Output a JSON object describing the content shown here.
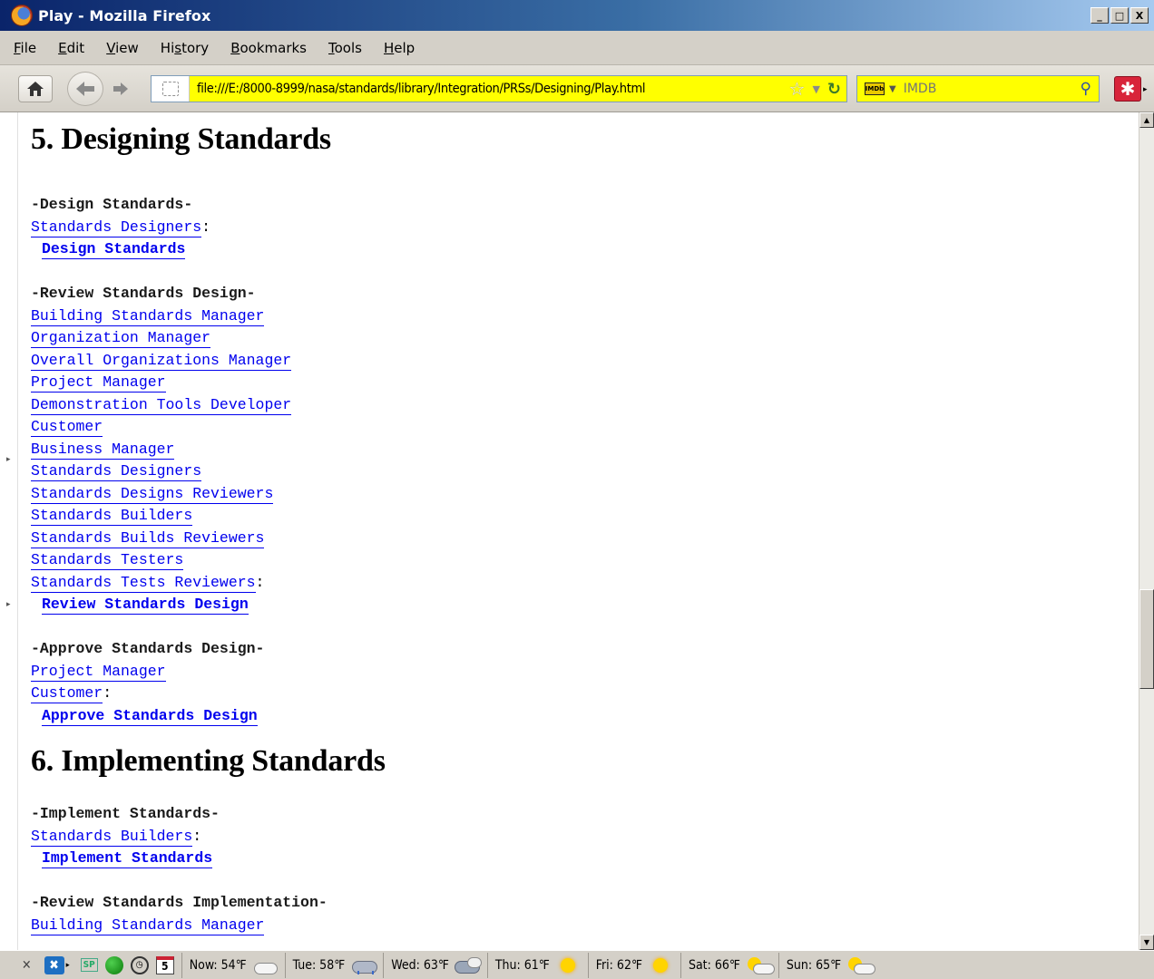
{
  "window": {
    "title": "Play - Mozilla Firefox",
    "buttons": {
      "minimize": "_",
      "maximize": "□",
      "close": "X"
    }
  },
  "menu": [
    {
      "prefix": "",
      "underlined": "F",
      "rest": "ile"
    },
    {
      "prefix": "",
      "underlined": "E",
      "rest": "dit"
    },
    {
      "prefix": "",
      "underlined": "V",
      "rest": "iew"
    },
    {
      "prefix": "Hi",
      "underlined": "s",
      "rest": "tory"
    },
    {
      "prefix": "",
      "underlined": "B",
      "rest": "ookmarks"
    },
    {
      "prefix": "",
      "underlined": "T",
      "rest": "ools"
    },
    {
      "prefix": "",
      "underlined": "H",
      "rest": "elp"
    }
  ],
  "navbar": {
    "url": "file:///E:/8000-8999/nasa/standards/library/Integration/PRSs/Designing/Play.html",
    "search_engine": "IMDB",
    "search_placeholder": "IMDB",
    "icons": {
      "home": "home-icon",
      "back": "back-arrow-icon",
      "forward": "forward-arrow-icon",
      "bookmark_star": "star-icon",
      "reload": "reload-icon",
      "search": "magnifier-icon",
      "addon": "addon-icon"
    },
    "accent_color": "#ffff00"
  },
  "content": {
    "link_color": "#0000ee",
    "section5": {
      "heading": "5. Designing Standards",
      "design": {
        "label": "-Design Standards-",
        "roles": [
          "Standards Designers"
        ],
        "action": "Design Standards"
      },
      "review": {
        "label": "-Review Standards Design-",
        "roles": [
          "Building Standards Manager",
          "Organization Manager",
          "Overall Organizations Manager",
          "Project Manager ",
          "Demonstration Tools Developer ",
          "Customer ",
          "Business Manager ",
          "Standards Designers ",
          "Standards Designs Reviewers",
          "Standards Builders ",
          "Standards Builds Reviewers",
          "Standards Testers",
          "Standards Tests Reviewers"
        ],
        "action": "Review Standards Design"
      },
      "approve": {
        "label": "-Approve Standards Design-",
        "roles": [
          "Project Manager",
          "Customer"
        ],
        "action": "Approve Standards Design"
      }
    },
    "section6": {
      "heading": "6. Implementing Standards",
      "implement": {
        "label": "-Implement Standards-",
        "roles": [
          "Standards Builders"
        ],
        "action": "Implement Standards"
      },
      "review": {
        "label": "-Review Standards Implementation-",
        "roles": [
          "Building Standards Manager"
        ]
      }
    }
  },
  "statusbar": {
    "weather": [
      {
        "label": "Now: 54℉",
        "icon": "cloud"
      },
      {
        "label": "Tue: 58℉",
        "icon": "rain"
      },
      {
        "label": "Wed: 63℉",
        "icon": "cloudrain"
      },
      {
        "label": "Thu: 61℉",
        "icon": "sun"
      },
      {
        "label": "Fri: 62℉",
        "icon": "sun"
      },
      {
        "label": "Sat: 66℉",
        "icon": "partly"
      },
      {
        "label": "Sun: 65℉",
        "icon": "partly"
      }
    ],
    "calendar_day": "5",
    "sp_label": "SP"
  }
}
